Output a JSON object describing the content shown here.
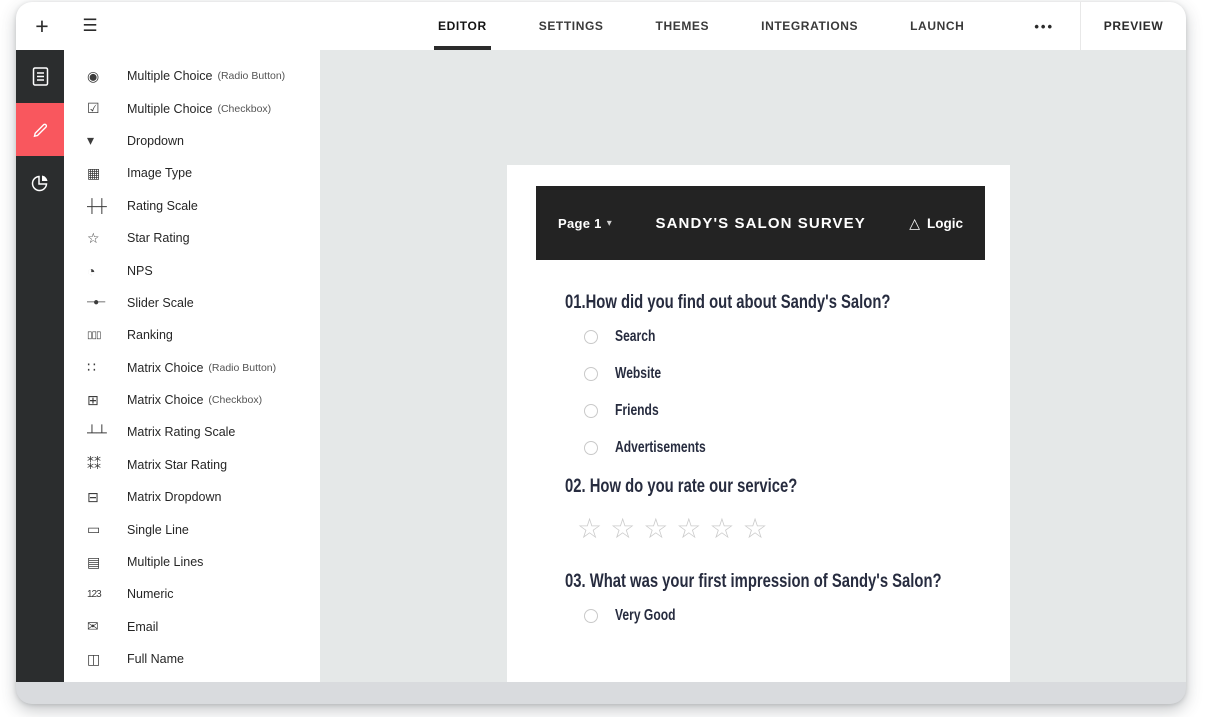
{
  "topbar": {
    "plus_icon": "+",
    "list_icon": "☰",
    "tabs": [
      {
        "label": "EDITOR",
        "active": true
      },
      {
        "label": "SETTINGS",
        "active": false
      },
      {
        "label": "THEMES",
        "active": false
      },
      {
        "label": "INTEGRATIONS",
        "active": false
      },
      {
        "label": "LAUNCH",
        "active": false
      }
    ],
    "more_label": "•••",
    "preview_label": "PREVIEW"
  },
  "rail": {
    "icons": [
      "document-icon",
      "pencil-icon",
      "pie-chart-icon"
    ],
    "active_icon": "pencil-icon"
  },
  "panel": {
    "items": [
      {
        "icon": "◉",
        "label": "Multiple Choice",
        "sublabel": "(Radio Button)"
      },
      {
        "icon": "☑",
        "label": "Multiple Choice",
        "sublabel": "(Checkbox)"
      },
      {
        "icon": "▾",
        "label": "Dropdown"
      },
      {
        "icon": "▦",
        "label": "Image Type"
      },
      {
        "icon": "┼┼",
        "label": "Rating Scale"
      },
      {
        "icon": "☆",
        "label": "Star Rating"
      },
      {
        "icon": "◔",
        "label": "NPS"
      },
      {
        "icon": "─●─",
        "label": "Slider Scale"
      },
      {
        "icon": "▯▯▯",
        "label": "Ranking"
      },
      {
        "icon": "∷",
        "label": "Matrix Choice",
        "sublabel": "(Radio Button)"
      },
      {
        "icon": "⊞",
        "label": "Matrix Choice",
        "sublabel": "(Checkbox)"
      },
      {
        "icon": "┴┴",
        "label": "Matrix Rating Scale"
      },
      {
        "icon": "⁑⁑",
        "label": "Matrix Star Rating"
      },
      {
        "icon": "⊟",
        "label": "Matrix Dropdown"
      },
      {
        "icon": "▭",
        "label": "Single Line"
      },
      {
        "icon": "▤",
        "label": "Multiple Lines"
      },
      {
        "icon": "123",
        "label": "Numeric"
      },
      {
        "icon": "✉",
        "label": "Email"
      },
      {
        "icon": "◫",
        "label": "Full Name"
      }
    ]
  },
  "survey": {
    "page_selector": "Page 1",
    "page_caret": "▾",
    "title": "SANDY'S SALON SURVEY",
    "logic_icon": "△",
    "logic_label": "Logic",
    "questions": [
      {
        "title": "01.How did you find out about Sandy's Salon?",
        "type": "radio",
        "options": [
          "Search",
          "Website",
          "Friends",
          "Advertisements"
        ]
      },
      {
        "title": "02. How do you rate our service?",
        "type": "star_rating",
        "star_count": 6,
        "stars_text": "☆☆☆☆☆☆"
      },
      {
        "title": "03. What was your first impression of Sandy's Salon?",
        "type": "radio",
        "options": [
          "Very Good"
        ]
      }
    ]
  },
  "colors": {
    "accent_red": "#f9575e",
    "rail_bg": "#2b2d2e",
    "survey_header_bg": "#232323",
    "main_bg": "#e5e8e8",
    "question_text": "#272c3f",
    "star_gray": "#cbcbcb"
  }
}
